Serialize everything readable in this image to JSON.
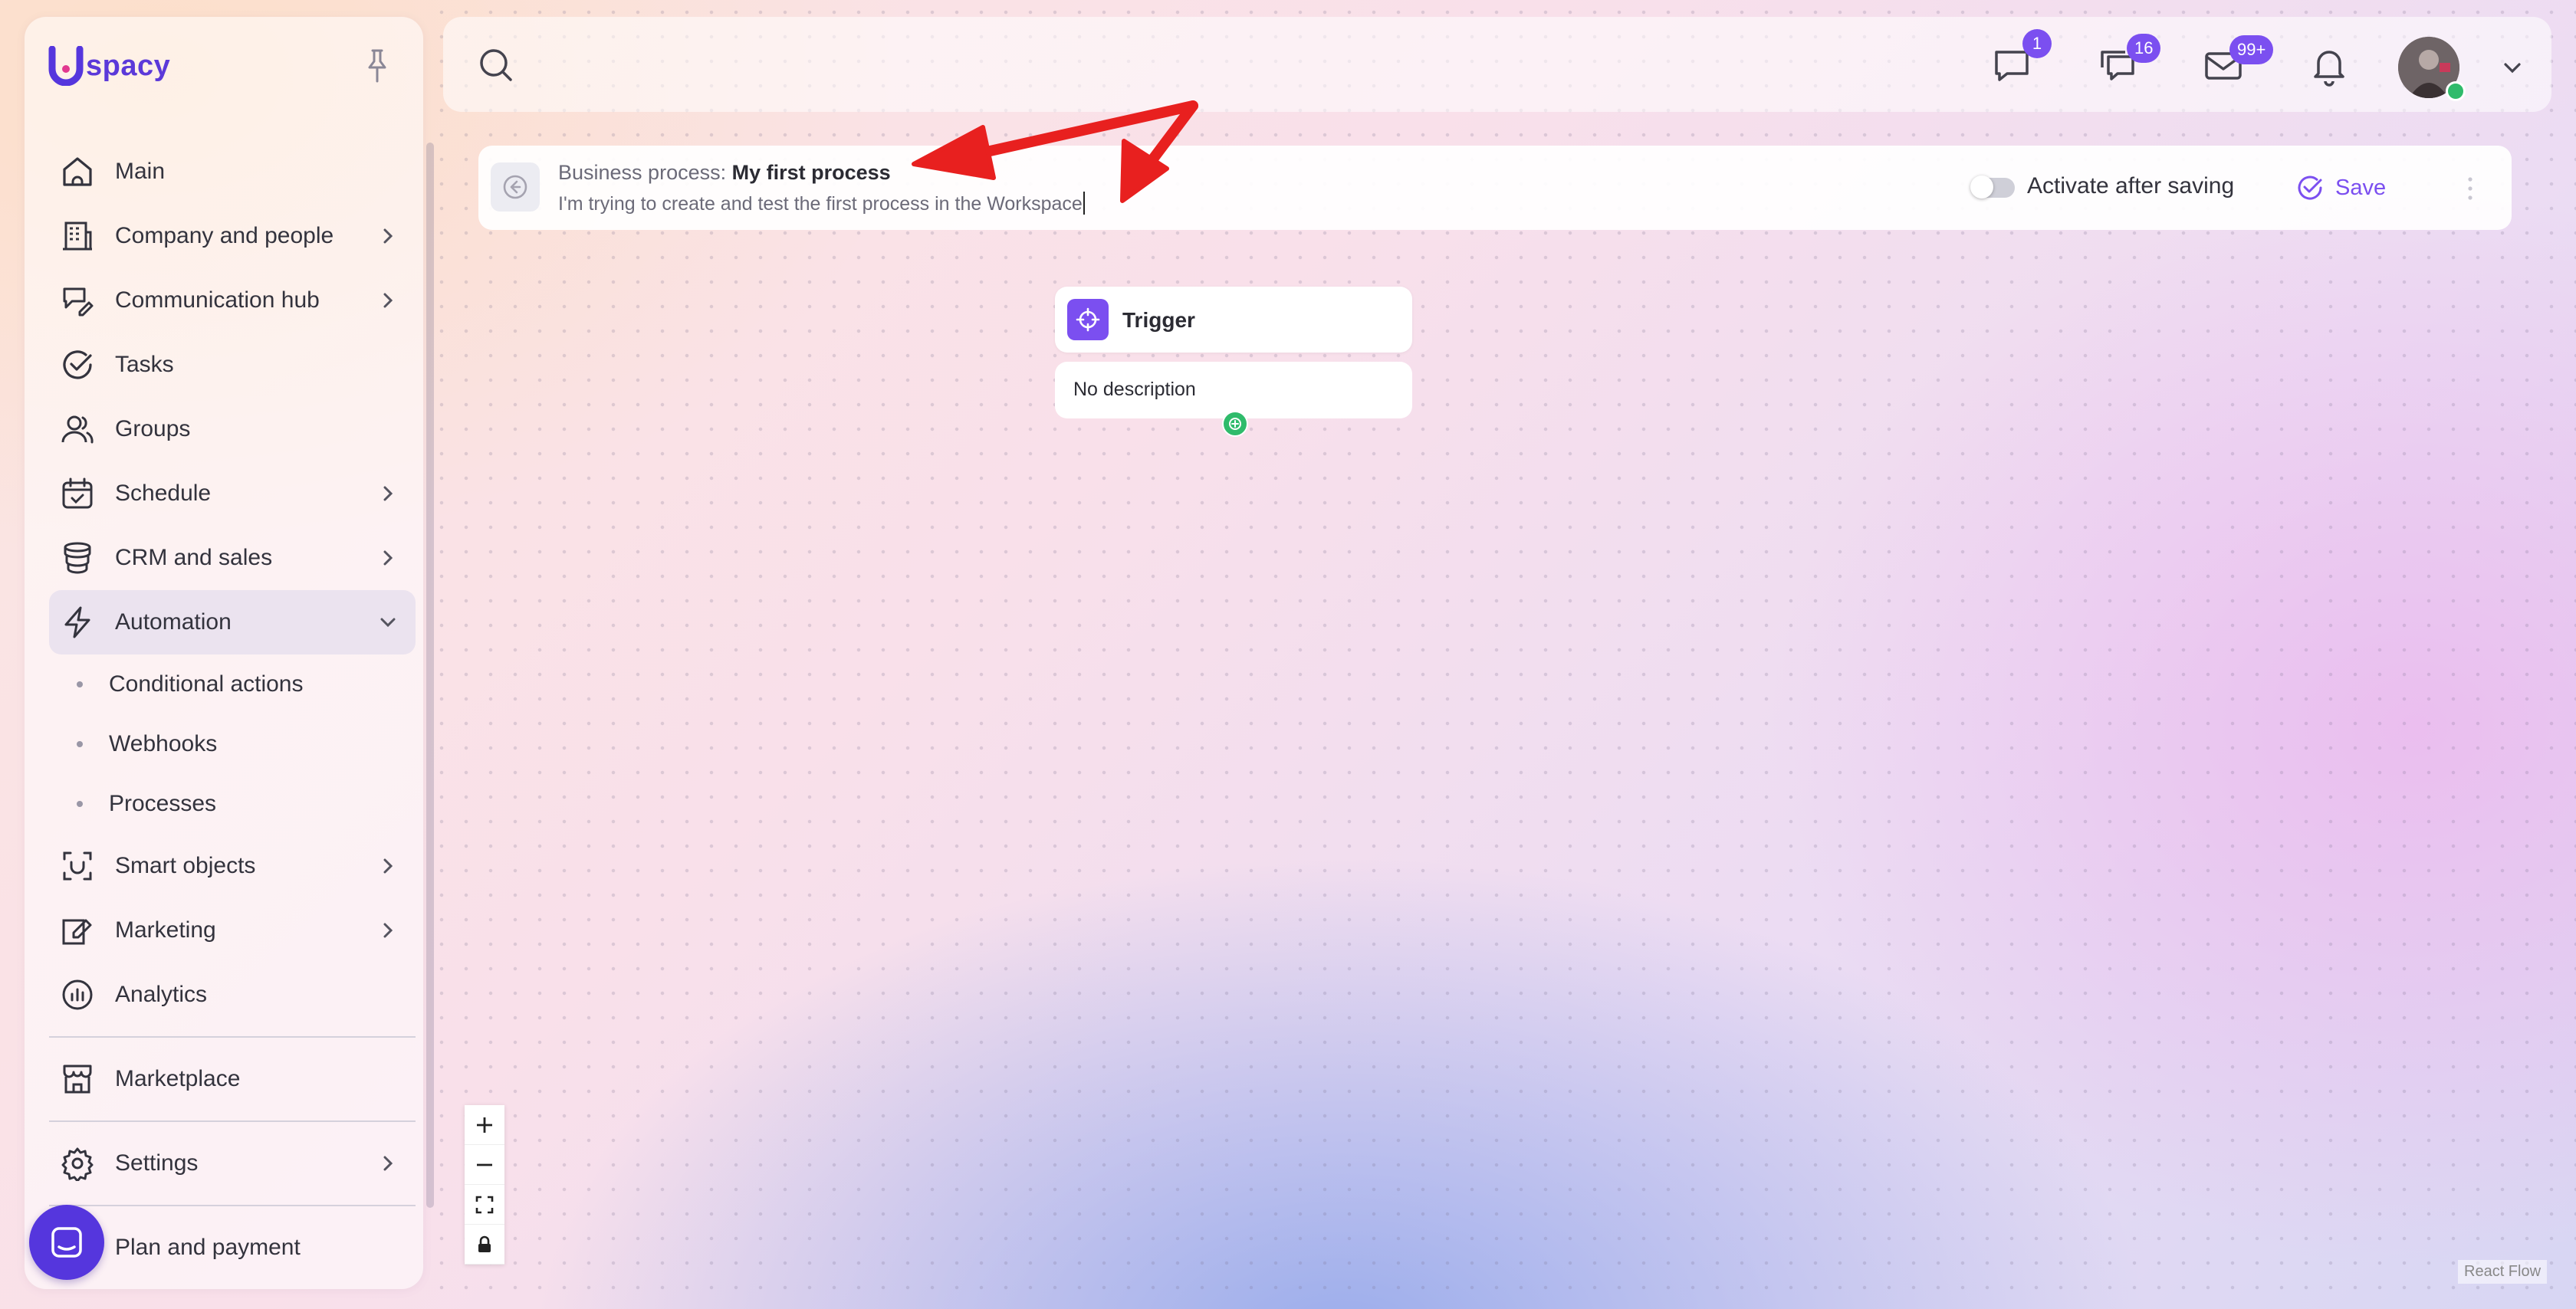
{
  "app": {
    "logo_text": "spacy",
    "logo_letter": "U"
  },
  "sidebar": {
    "items": [
      {
        "label": "Main",
        "icon": "home-icon"
      },
      {
        "label": "Company and people",
        "icon": "building-icon",
        "has_submenu": true
      },
      {
        "label": "Communication hub",
        "icon": "chat-edit-icon",
        "has_submenu": true
      },
      {
        "label": "Tasks",
        "icon": "check-circle-icon"
      },
      {
        "label": "Groups",
        "icon": "users-icon"
      },
      {
        "label": "Schedule",
        "icon": "calendar-icon",
        "has_submenu": true
      },
      {
        "label": "CRM and sales",
        "icon": "database-icon",
        "has_submenu": true
      },
      {
        "label": "Automation",
        "icon": "lightning-icon",
        "expanded": true
      }
    ],
    "automation_sub": [
      "Conditional actions",
      "Webhooks",
      "Processes"
    ],
    "items_after": [
      {
        "label": "Smart objects",
        "icon": "smart-object-icon",
        "has_submenu": true
      },
      {
        "label": "Marketing",
        "icon": "megaphone-icon",
        "has_submenu": true
      },
      {
        "label": "Analytics",
        "icon": "chart-icon"
      }
    ],
    "marketplace": "Marketplace",
    "settings": "Settings",
    "plan": "Plan and payment"
  },
  "topbar": {
    "notifications": [
      {
        "icon": "message-icon",
        "badge": "1"
      },
      {
        "icon": "chats-icon",
        "badge": "16"
      },
      {
        "icon": "mail-icon",
        "badge": "99+"
      },
      {
        "icon": "bell-icon",
        "badge": ""
      }
    ]
  },
  "process": {
    "prefix": "Business process:",
    "name": "My first process",
    "description": "I'm trying to create and test the first process in the Workspace",
    "activate_label": "Activate after saving",
    "activate_on": false,
    "save_label": "Save"
  },
  "canvas": {
    "trigger_title": "Trigger",
    "trigger_desc": "No description",
    "attribution": "React Flow"
  },
  "colors": {
    "accent": "#7b4ff0",
    "brand": "#5536dd",
    "online": "#2fbb6b",
    "annotation": "#e8201f"
  }
}
